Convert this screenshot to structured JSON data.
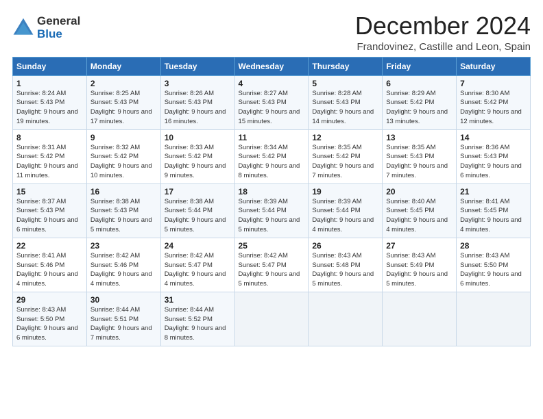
{
  "logo": {
    "general": "General",
    "blue": "Blue"
  },
  "title": "December 2024",
  "subtitle": "Frandovinez, Castille and Leon, Spain",
  "days_of_week": [
    "Sunday",
    "Monday",
    "Tuesday",
    "Wednesday",
    "Thursday",
    "Friday",
    "Saturday"
  ],
  "weeks": [
    [
      {
        "day": "1",
        "sunrise": "Sunrise: 8:24 AM",
        "sunset": "Sunset: 5:43 PM",
        "daylight": "Daylight: 9 hours and 19 minutes."
      },
      {
        "day": "2",
        "sunrise": "Sunrise: 8:25 AM",
        "sunset": "Sunset: 5:43 PM",
        "daylight": "Daylight: 9 hours and 17 minutes."
      },
      {
        "day": "3",
        "sunrise": "Sunrise: 8:26 AM",
        "sunset": "Sunset: 5:43 PM",
        "daylight": "Daylight: 9 hours and 16 minutes."
      },
      {
        "day": "4",
        "sunrise": "Sunrise: 8:27 AM",
        "sunset": "Sunset: 5:43 PM",
        "daylight": "Daylight: 9 hours and 15 minutes."
      },
      {
        "day": "5",
        "sunrise": "Sunrise: 8:28 AM",
        "sunset": "Sunset: 5:43 PM",
        "daylight": "Daylight: 9 hours and 14 minutes."
      },
      {
        "day": "6",
        "sunrise": "Sunrise: 8:29 AM",
        "sunset": "Sunset: 5:42 PM",
        "daylight": "Daylight: 9 hours and 13 minutes."
      },
      {
        "day": "7",
        "sunrise": "Sunrise: 8:30 AM",
        "sunset": "Sunset: 5:42 PM",
        "daylight": "Daylight: 9 hours and 12 minutes."
      }
    ],
    [
      {
        "day": "8",
        "sunrise": "Sunrise: 8:31 AM",
        "sunset": "Sunset: 5:42 PM",
        "daylight": "Daylight: 9 hours and 11 minutes."
      },
      {
        "day": "9",
        "sunrise": "Sunrise: 8:32 AM",
        "sunset": "Sunset: 5:42 PM",
        "daylight": "Daylight: 9 hours and 10 minutes."
      },
      {
        "day": "10",
        "sunrise": "Sunrise: 8:33 AM",
        "sunset": "Sunset: 5:42 PM",
        "daylight": "Daylight: 9 hours and 9 minutes."
      },
      {
        "day": "11",
        "sunrise": "Sunrise: 8:34 AM",
        "sunset": "Sunset: 5:42 PM",
        "daylight": "Daylight: 9 hours and 8 minutes."
      },
      {
        "day": "12",
        "sunrise": "Sunrise: 8:35 AM",
        "sunset": "Sunset: 5:42 PM",
        "daylight": "Daylight: 9 hours and 7 minutes."
      },
      {
        "day": "13",
        "sunrise": "Sunrise: 8:35 AM",
        "sunset": "Sunset: 5:43 PM",
        "daylight": "Daylight: 9 hours and 7 minutes."
      },
      {
        "day": "14",
        "sunrise": "Sunrise: 8:36 AM",
        "sunset": "Sunset: 5:43 PM",
        "daylight": "Daylight: 9 hours and 6 minutes."
      }
    ],
    [
      {
        "day": "15",
        "sunrise": "Sunrise: 8:37 AM",
        "sunset": "Sunset: 5:43 PM",
        "daylight": "Daylight: 9 hours and 6 minutes."
      },
      {
        "day": "16",
        "sunrise": "Sunrise: 8:38 AM",
        "sunset": "Sunset: 5:43 PM",
        "daylight": "Daylight: 9 hours and 5 minutes."
      },
      {
        "day": "17",
        "sunrise": "Sunrise: 8:38 AM",
        "sunset": "Sunset: 5:44 PM",
        "daylight": "Daylight: 9 hours and 5 minutes."
      },
      {
        "day": "18",
        "sunrise": "Sunrise: 8:39 AM",
        "sunset": "Sunset: 5:44 PM",
        "daylight": "Daylight: 9 hours and 5 minutes."
      },
      {
        "day": "19",
        "sunrise": "Sunrise: 8:39 AM",
        "sunset": "Sunset: 5:44 PM",
        "daylight": "Daylight: 9 hours and 4 minutes."
      },
      {
        "day": "20",
        "sunrise": "Sunrise: 8:40 AM",
        "sunset": "Sunset: 5:45 PM",
        "daylight": "Daylight: 9 hours and 4 minutes."
      },
      {
        "day": "21",
        "sunrise": "Sunrise: 8:41 AM",
        "sunset": "Sunset: 5:45 PM",
        "daylight": "Daylight: 9 hours and 4 minutes."
      }
    ],
    [
      {
        "day": "22",
        "sunrise": "Sunrise: 8:41 AM",
        "sunset": "Sunset: 5:46 PM",
        "daylight": "Daylight: 9 hours and 4 minutes."
      },
      {
        "day": "23",
        "sunrise": "Sunrise: 8:42 AM",
        "sunset": "Sunset: 5:46 PM",
        "daylight": "Daylight: 9 hours and 4 minutes."
      },
      {
        "day": "24",
        "sunrise": "Sunrise: 8:42 AM",
        "sunset": "Sunset: 5:47 PM",
        "daylight": "Daylight: 9 hours and 4 minutes."
      },
      {
        "day": "25",
        "sunrise": "Sunrise: 8:42 AM",
        "sunset": "Sunset: 5:47 PM",
        "daylight": "Daylight: 9 hours and 5 minutes."
      },
      {
        "day": "26",
        "sunrise": "Sunrise: 8:43 AM",
        "sunset": "Sunset: 5:48 PM",
        "daylight": "Daylight: 9 hours and 5 minutes."
      },
      {
        "day": "27",
        "sunrise": "Sunrise: 8:43 AM",
        "sunset": "Sunset: 5:49 PM",
        "daylight": "Daylight: 9 hours and 5 minutes."
      },
      {
        "day": "28",
        "sunrise": "Sunrise: 8:43 AM",
        "sunset": "Sunset: 5:50 PM",
        "daylight": "Daylight: 9 hours and 6 minutes."
      }
    ],
    [
      {
        "day": "29",
        "sunrise": "Sunrise: 8:43 AM",
        "sunset": "Sunset: 5:50 PM",
        "daylight": "Daylight: 9 hours and 6 minutes."
      },
      {
        "day": "30",
        "sunrise": "Sunrise: 8:44 AM",
        "sunset": "Sunset: 5:51 PM",
        "daylight": "Daylight: 9 hours and 7 minutes."
      },
      {
        "day": "31",
        "sunrise": "Sunrise: 8:44 AM",
        "sunset": "Sunset: 5:52 PM",
        "daylight": "Daylight: 9 hours and 8 minutes."
      },
      null,
      null,
      null,
      null
    ]
  ]
}
